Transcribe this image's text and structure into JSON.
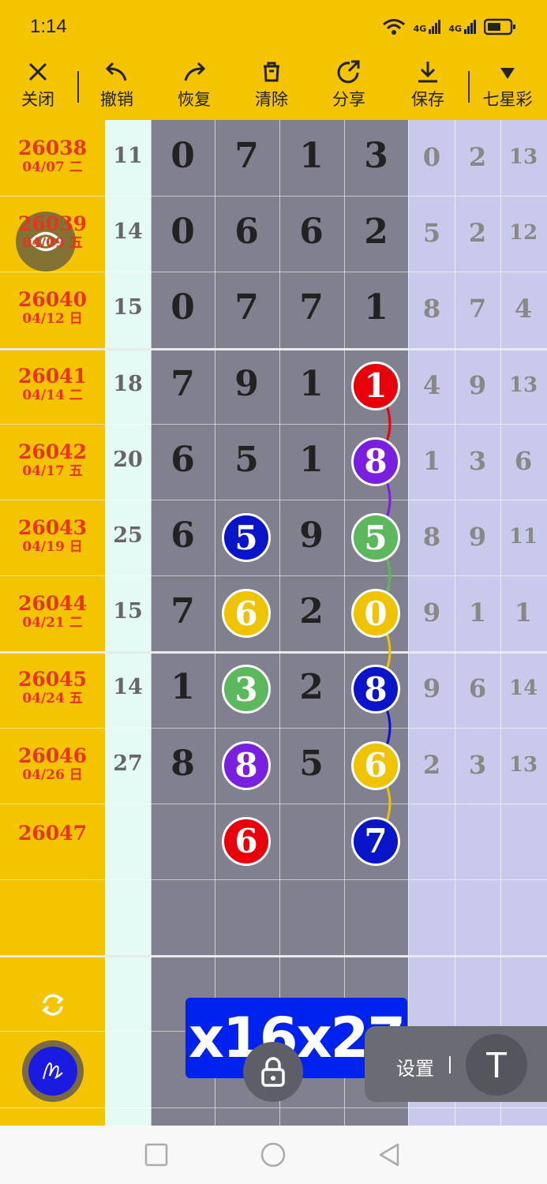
{
  "status": {
    "time": "1:14",
    "net1": "4G",
    "net2": "4G"
  },
  "toolbar": {
    "close": "关闭",
    "undo": "撤销",
    "redo": "恢复",
    "clear": "清除",
    "share": "分享",
    "save": "保存",
    "lottery": "七星彩"
  },
  "rows": [
    {
      "issue": "26038",
      "date": "04/07 二",
      "sum": "11",
      "d": [
        "0",
        "7",
        "1",
        "3"
      ],
      "r": [
        "0",
        "2",
        "13"
      ]
    },
    {
      "issue": "26039",
      "date": "04/09 五",
      "sum": "14",
      "d": [
        "0",
        "6",
        "6",
        "2"
      ],
      "r": [
        "5",
        "2",
        "12"
      ]
    },
    {
      "issue": "26040",
      "date": "04/12 日",
      "sum": "15",
      "d": [
        "0",
        "7",
        "7",
        "1"
      ],
      "r": [
        "8",
        "7",
        "4"
      ]
    },
    {
      "issue": "26041",
      "date": "04/14 二",
      "sum": "18",
      "d": [
        "7",
        "9",
        "1",
        "1"
      ],
      "r": [
        "4",
        "9",
        "13"
      ]
    },
    {
      "issue": "26042",
      "date": "04/17 五",
      "sum": "20",
      "d": [
        "6",
        "5",
        "1",
        "8"
      ],
      "r": [
        "1",
        "3",
        "6"
      ]
    },
    {
      "issue": "26043",
      "date": "04/19 日",
      "sum": "25",
      "d": [
        "6",
        "5",
        "9",
        "5"
      ],
      "r": [
        "8",
        "9",
        "11"
      ]
    },
    {
      "issue": "26044",
      "date": "04/21 二",
      "sum": "15",
      "d": [
        "7",
        "6",
        "2",
        "0"
      ],
      "r": [
        "9",
        "1",
        "1"
      ]
    },
    {
      "issue": "26045",
      "date": "04/24 五",
      "sum": "14",
      "d": [
        "1",
        "3",
        "2",
        "8"
      ],
      "r": [
        "9",
        "6",
        "14"
      ]
    },
    {
      "issue": "26046",
      "date": "04/26 日",
      "sum": "27",
      "d": [
        "8",
        "8",
        "5",
        "6"
      ],
      "r": [
        "2",
        "3",
        "13"
      ]
    },
    {
      "issue": "26047",
      "date": "",
      "sum": "",
      "d": [
        "",
        "6",
        "",
        "7"
      ],
      "r": [
        "",
        "",
        ""
      ]
    }
  ],
  "balls": [
    {
      "row": 3,
      "col": 3,
      "color": "#e8000b"
    },
    {
      "row": 4,
      "col": 3,
      "color": "#7a1ee0"
    },
    {
      "row": 5,
      "col": 1,
      "color": "#0a14c8"
    },
    {
      "row": 5,
      "col": 3,
      "color": "#5cb85c"
    },
    {
      "row": 6,
      "col": 1,
      "color": "#efc300"
    },
    {
      "row": 6,
      "col": 3,
      "color": "#efc300"
    },
    {
      "row": 7,
      "col": 1,
      "color": "#5cb85c"
    },
    {
      "row": 7,
      "col": 3,
      "color": "#0a14c8"
    },
    {
      "row": 8,
      "col": 1,
      "color": "#7a1ee0"
    },
    {
      "row": 8,
      "col": 3,
      "color": "#efc300"
    },
    {
      "row": 9,
      "col": 1,
      "color": "#e8000b"
    },
    {
      "row": 9,
      "col": 3,
      "color": "#0a14c8"
    }
  ],
  "overlay_text": "x16x27",
  "settings": {
    "label": "设置",
    "t_label": "T"
  },
  "icons": {
    "eye": "eye-icon",
    "pen": "pen-icon",
    "refresh": "refresh-icon",
    "lock": "lock-icon"
  }
}
